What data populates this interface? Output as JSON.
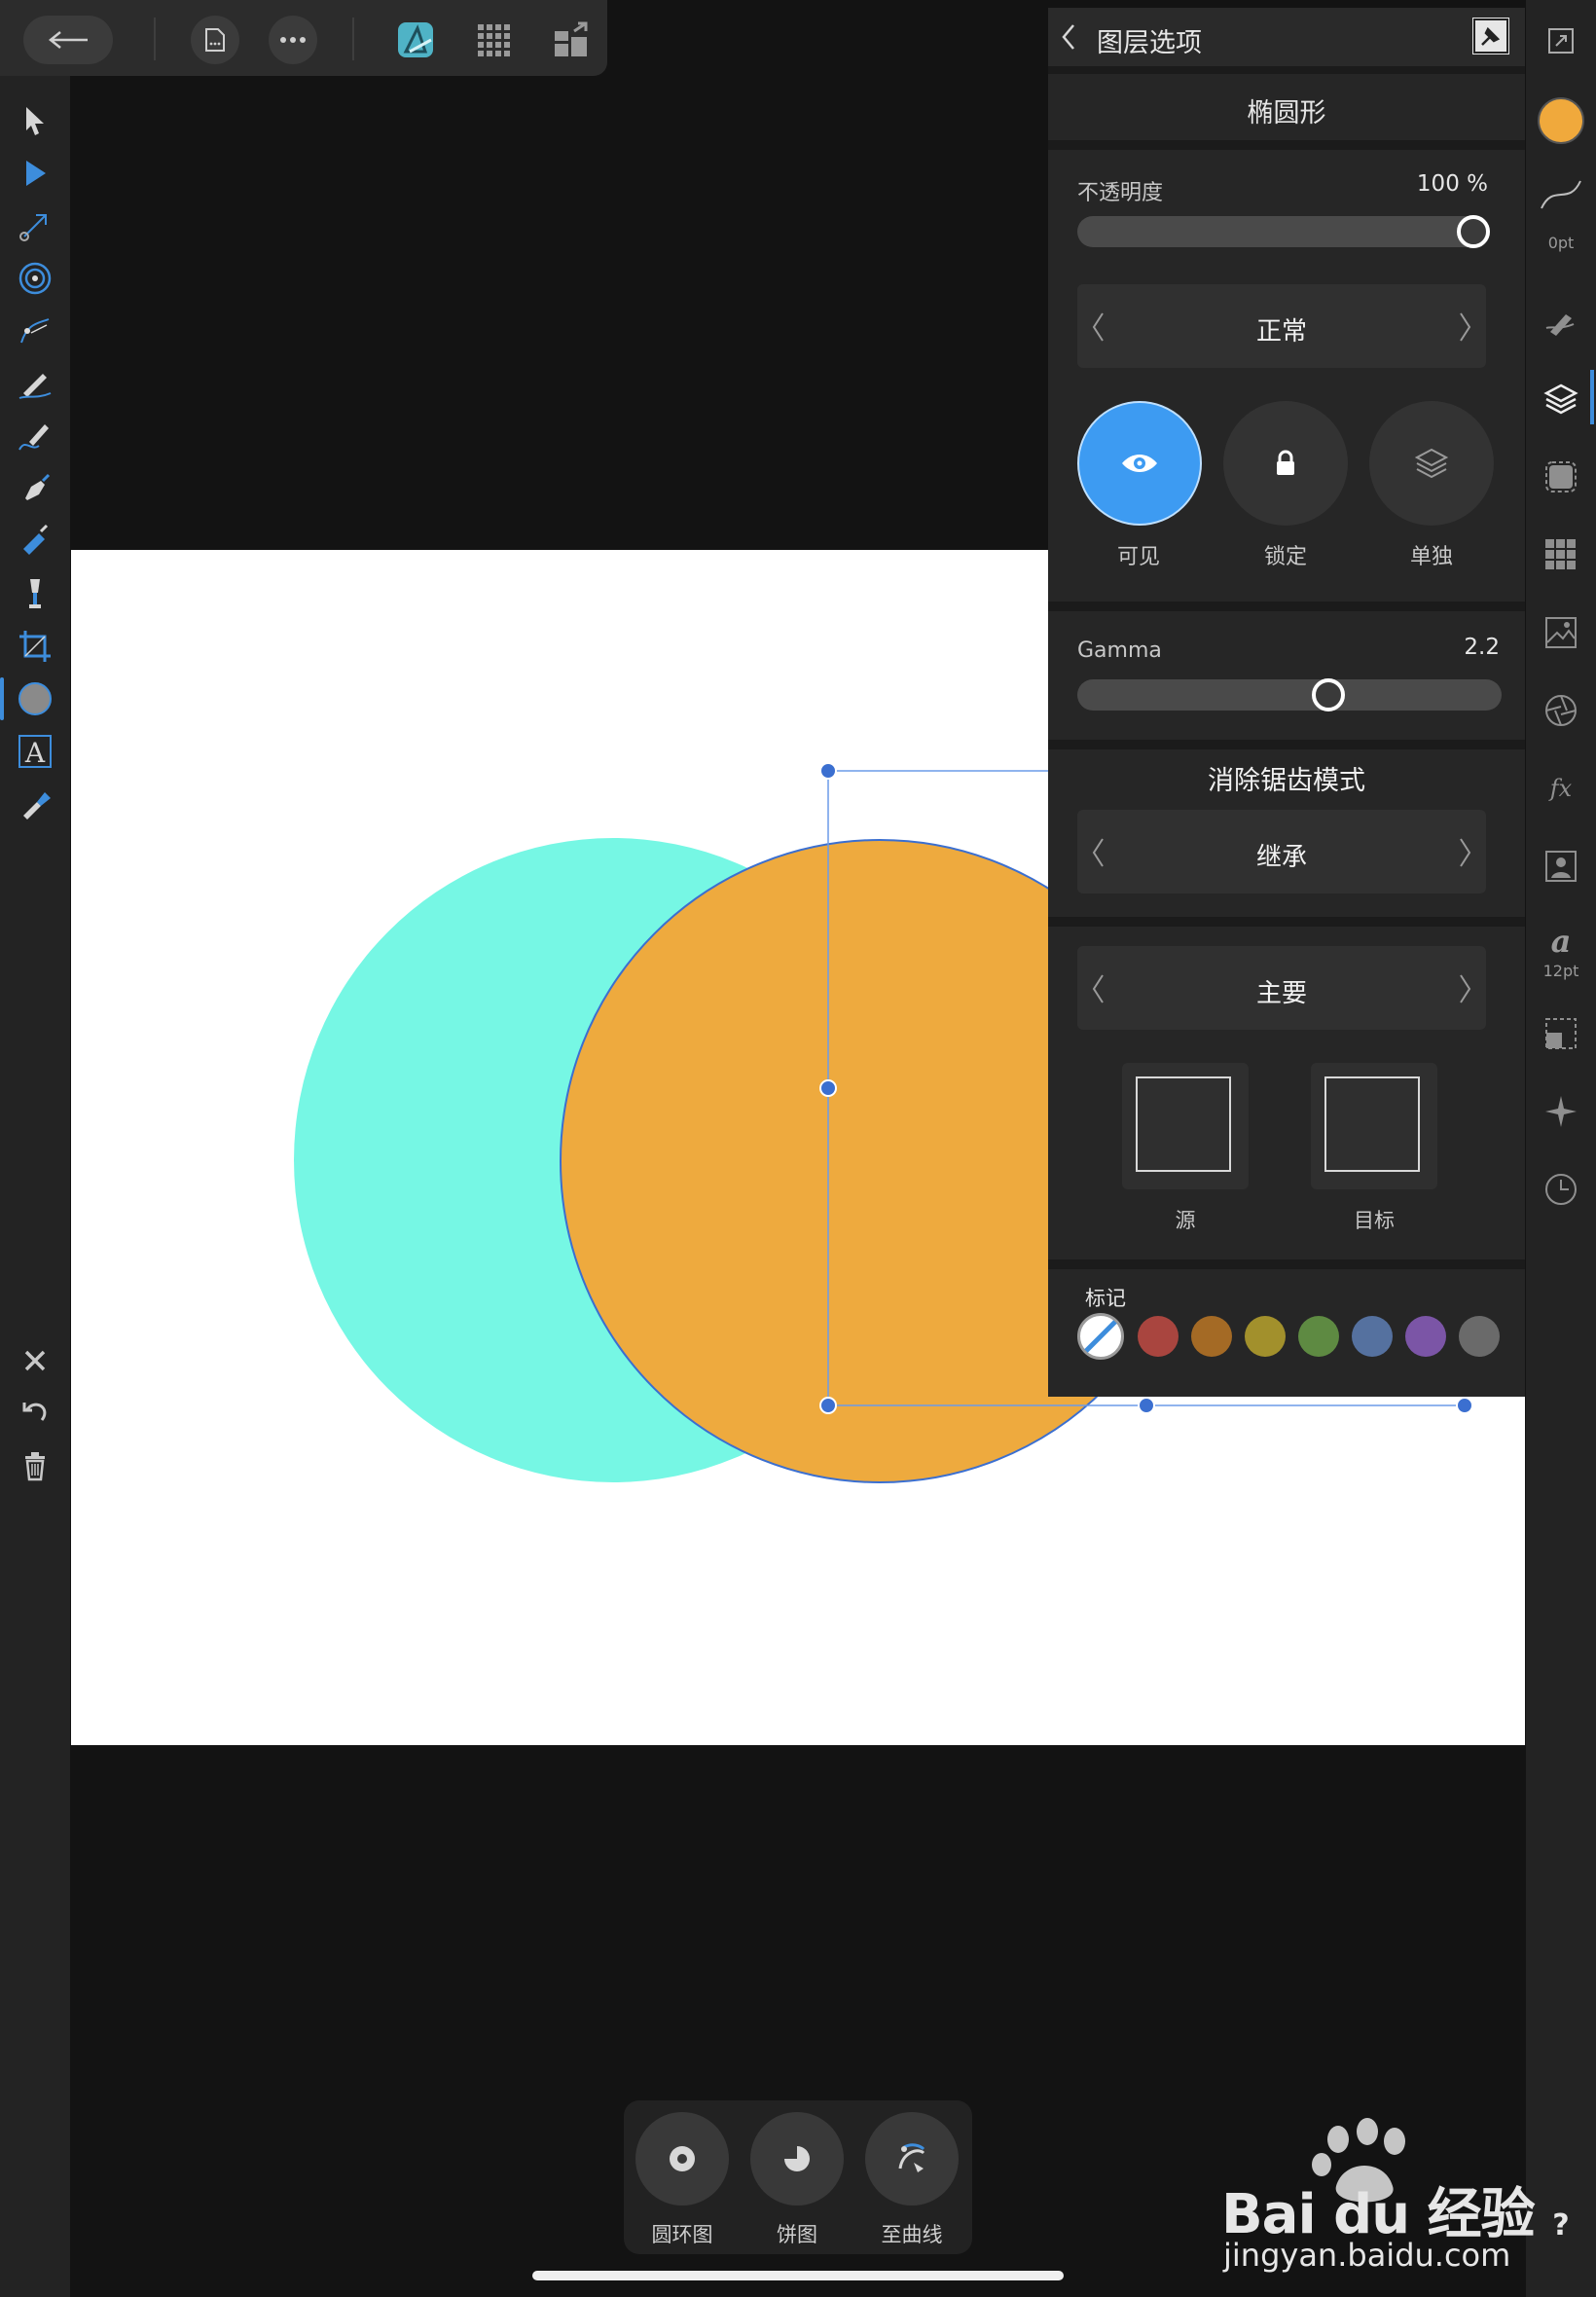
{
  "panel": {
    "title": "图层选项",
    "layer_name": "椭圆形",
    "opacity": {
      "label": "不透明度",
      "value": "100 %",
      "fraction": 1.0
    },
    "blend_mode": "正常",
    "toggles": {
      "visible": "可见",
      "lock": "锁定",
      "isolate": "单独"
    },
    "gamma": {
      "label": "Gamma",
      "value": "2.2",
      "fraction": 0.6
    },
    "antialias": {
      "title": "消除锯齿模式",
      "value": "继承"
    },
    "channel": {
      "value": "主要",
      "source_label": "源",
      "target_label": "目标"
    },
    "tags": {
      "label": "标记",
      "colors": [
        "#a9453f",
        "#a46a25",
        "#a2902c",
        "#5e8a42",
        "#55719f",
        "#7b55a6",
        "#6a6a6a"
      ]
    }
  },
  "right_strip": {
    "stroke_width": "0pt",
    "font_size": "12pt",
    "fill_color": "#f0a93c"
  },
  "context_bar": {
    "donut": "圆环图",
    "pie": "饼图",
    "to_curves": "至曲线"
  },
  "canvas": {
    "shape1_color": "#76f7e4",
    "shape2_color": "#eeaa3e"
  },
  "watermark": {
    "brand": "Bai du 经验",
    "url": "jingyan.baidu.com"
  },
  "accent": "#3d8ddc"
}
